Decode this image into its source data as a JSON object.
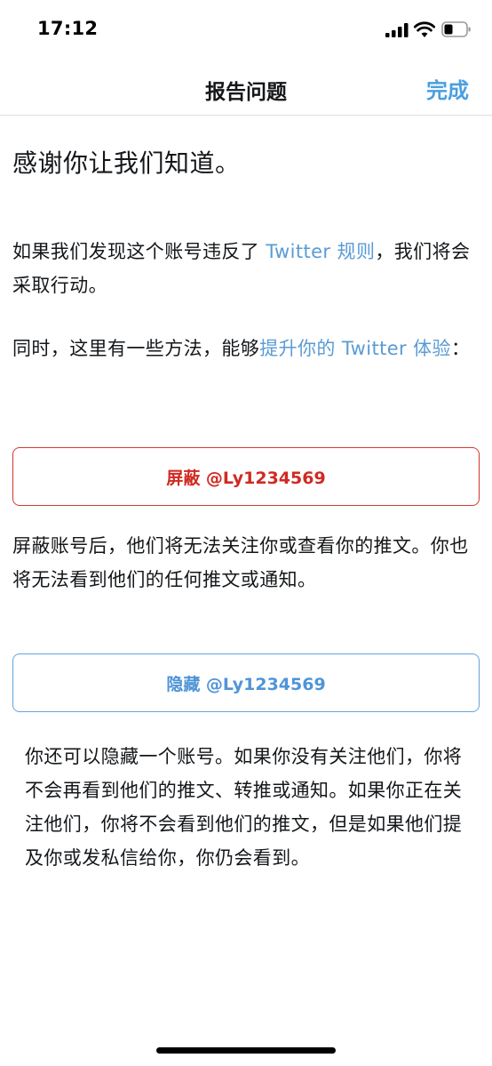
{
  "status_bar": {
    "time": "17:12",
    "icons": [
      "signal-icon",
      "wifi-icon",
      "battery-icon"
    ]
  },
  "nav": {
    "title": "报告问题",
    "done_label": "完成"
  },
  "content": {
    "heading": "感谢你让我们知道。",
    "p1": {
      "before": "如果我们发现这个账号违反了 ",
      "link": "Twitter 规则",
      "after": "，我们将会采取行动。"
    },
    "p2": {
      "before": "同时，这里有一些方法，能够",
      "link": "提升你的 Twitter 体验",
      "after": "："
    },
    "block_button": "屏蔽 @Ly1234569",
    "block_desc": "屏蔽账号后，他们将无法关注你或查看你的推文。你也将无法看到他们的任何推文或通知。",
    "mute_button": "隐藏 @Ly1234569",
    "mute_desc": "你还可以隐藏一个账号。如果你没有关注他们，你将不会再看到他们的推文、转推或通知。如果你正在关注他们，你将不会看到他们的推文，但是如果他们提及你或发私信给你，你仍会看到。"
  },
  "colors": {
    "link": "#5a9bd4",
    "accent": "#4a9fe0",
    "danger": "#d02a22"
  }
}
